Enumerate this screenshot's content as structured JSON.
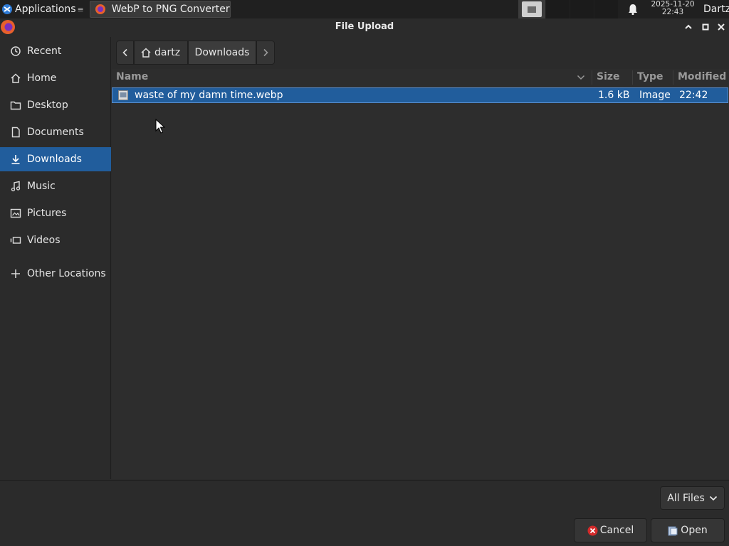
{
  "taskbar": {
    "applications_label": "Applications",
    "separator": "≡",
    "window_title": "WebP to PNG Converter ...",
    "clock_date": "2025-11-20",
    "clock_time": "22:43",
    "user": "Dartz"
  },
  "dialog": {
    "title": "File Upload"
  },
  "sidebar": {
    "items": [
      {
        "label": "Recent",
        "icon": "clock-icon"
      },
      {
        "label": "Home",
        "icon": "home-icon"
      },
      {
        "label": "Desktop",
        "icon": "folder-icon"
      },
      {
        "label": "Documents",
        "icon": "document-icon"
      },
      {
        "label": "Downloads",
        "icon": "download-icon",
        "active": true
      },
      {
        "label": "Music",
        "icon": "music-icon"
      },
      {
        "label": "Pictures",
        "icon": "pictures-icon"
      },
      {
        "label": "Videos",
        "icon": "video-icon"
      },
      {
        "label": "Other Locations",
        "icon": "plus-icon"
      }
    ]
  },
  "pathbar": {
    "home_label": "dartz",
    "current_label": "Downloads"
  },
  "filelist": {
    "columns": [
      "Name",
      "Size",
      "Type",
      "Modified"
    ],
    "rows": [
      {
        "name": "waste of my damn time.webp",
        "size": "1.6 kB",
        "type": "Image",
        "modified": "22:42",
        "selected": true
      }
    ]
  },
  "footer": {
    "filter_label": "All Files",
    "cancel_label": "Cancel",
    "open_label": "Open"
  },
  "colors": {
    "selection": "#215d9c",
    "background": "#2b2b2b",
    "cancel_icon": "#d42a2a"
  }
}
